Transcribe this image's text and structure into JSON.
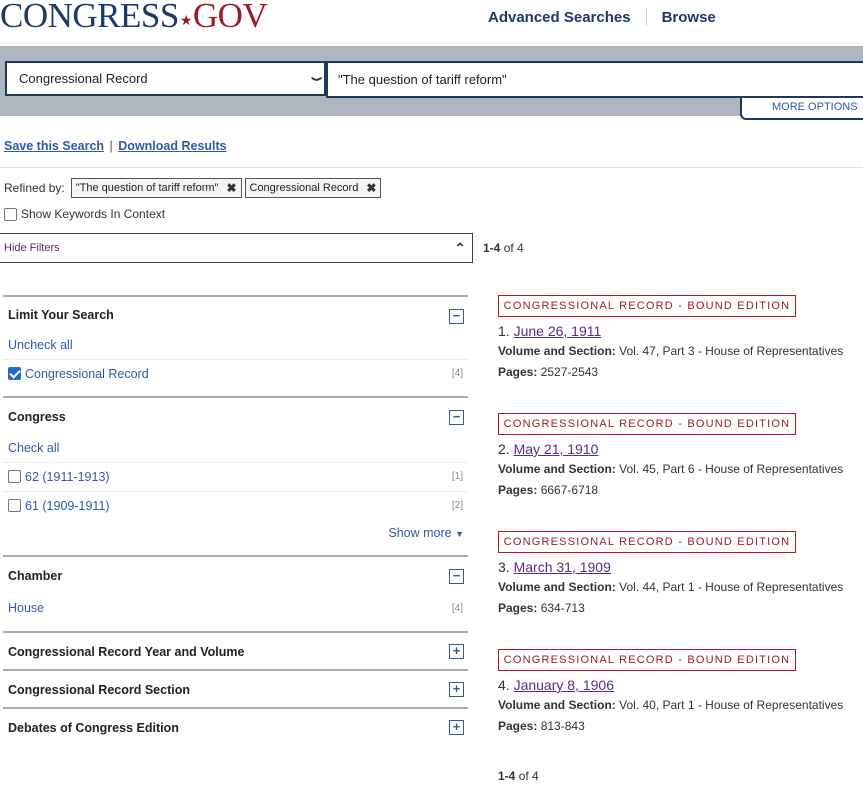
{
  "header": {
    "logo_part1": "CONGRESS",
    "logo_star": "★",
    "logo_part2": "GOV",
    "nav": [
      "Advanced Searches",
      "Browse"
    ]
  },
  "search": {
    "collection": "Congressional Record",
    "query": "\"The question of tariff reform\"",
    "more_options": "MORE OPTIONS"
  },
  "actions": {
    "save": "Save this Search",
    "separator": "|",
    "download": "Download Results"
  },
  "refined": {
    "label": "Refined by:",
    "chips": [
      "\"The question of tariff reform\"",
      "Congressional Record"
    ],
    "remove_glyph": "✖"
  },
  "kwic_label": "Show Keywords In Context",
  "hide_filters": "Hide Filters",
  "count": {
    "range": "1-4",
    "of": "of 4"
  },
  "facets": {
    "limit": {
      "title": "Limit Your Search",
      "toggle": "−",
      "uncheck": "Uncheck all",
      "items": [
        {
          "label": "Congressional Record",
          "count": "[4]",
          "checked": true
        }
      ]
    },
    "congress": {
      "title": "Congress",
      "toggle": "−",
      "check": "Check all",
      "items": [
        {
          "label": "62 (1911-1913)",
          "count": "[1]",
          "checked": false
        },
        {
          "label": "61 (1909-1911)",
          "count": "[2]",
          "checked": false
        }
      ],
      "show_more": "Show more"
    },
    "chamber": {
      "title": "Chamber",
      "toggle": "−",
      "items": [
        {
          "label": "House",
          "count": "[4]"
        }
      ]
    },
    "collapsed": [
      {
        "title": "Congressional Record Year and Volume",
        "toggle": "+"
      },
      {
        "title": "Congressional Record Section",
        "toggle": "+"
      },
      {
        "title": "Debates of Congress Edition",
        "toggle": "+"
      }
    ]
  },
  "results": [
    {
      "badge": "CONGRESSIONAL RECORD - BOUND EDITION",
      "num": "1.",
      "date": "June 26, 1911",
      "vol_label": "Volume and Section:",
      "vol": "Vol. 47, Part 3 - House of Representatives",
      "pages_label": "Pages:",
      "pages": "2527-2543"
    },
    {
      "badge": "CONGRESSIONAL RECORD - BOUND EDITION",
      "num": "2.",
      "date": "May 21, 1910",
      "vol_label": "Volume and Section:",
      "vol": "Vol. 45, Part 6 - House of Representatives",
      "pages_label": "Pages:",
      "pages": "6667-6718"
    },
    {
      "badge": "CONGRESSIONAL RECORD - BOUND EDITION",
      "num": "3.",
      "date": "March 31, 1909",
      "vol_label": "Volume and Section:",
      "vol": "Vol. 44, Part 1 - House of Representatives",
      "pages_label": "Pages:",
      "pages": "634-713"
    },
    {
      "badge": "CONGRESSIONAL RECORD - BOUND EDITION",
      "num": "4.",
      "date": "January 8, 1906",
      "vol_label": "Volume and Section:",
      "vol": "Vol. 40, Part 1 - House of Representatives",
      "pages_label": "Pages:",
      "pages": "813-843"
    }
  ],
  "colors": {
    "navy": "#1b3a6b",
    "brand_red": "#9c1c28",
    "link": "#2f5aa7",
    "visited": "#5b2a8a",
    "band": "#adb5bf"
  }
}
